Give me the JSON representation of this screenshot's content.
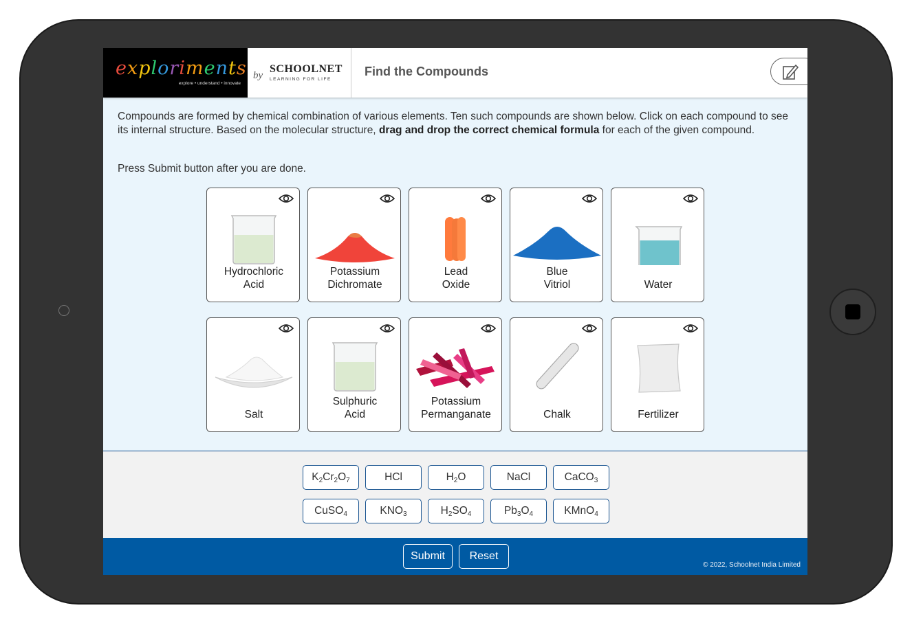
{
  "app": {
    "logo_text": "explorimenta",
    "logo_tagline": "explore • understand • innovate",
    "by": "by",
    "schoolnet_name": "SCHOOLNET",
    "schoolnet_tag": "LEARNING FOR LIFE",
    "title": "Find the Compounds",
    "notes_icon": "edit-note-icon"
  },
  "instructions": {
    "part1": "Compounds are formed by chemical combination of various elements. Ten such compounds are shown below. Click on each compound to see its internal structure. Based on the molecular structure, ",
    "bold1": "drag and drop the correct chemical formula",
    "part2": " for each of the given compound.",
    "line2": "Press Submit button after you are done."
  },
  "compounds": [
    {
      "line1": "Hydrochloric",
      "line2": "Acid"
    },
    {
      "line1": "Potassium",
      "line2": "Dichromate"
    },
    {
      "line1": "Lead",
      "line2": "Oxide"
    },
    {
      "line1": "Blue",
      "line2": "Vitriol"
    },
    {
      "line1": "Water",
      "line2": ""
    },
    {
      "line1": "Salt",
      "line2": ""
    },
    {
      "line1": "Sulphuric",
      "line2": "Acid"
    },
    {
      "line1": "Potassium",
      "line2": "Permanganate"
    },
    {
      "line1": "Chalk",
      "line2": ""
    },
    {
      "line1": "Fertilizer",
      "line2": ""
    }
  ],
  "formulas": [
    {
      "parts": [
        "K",
        "2",
        "Cr",
        "2",
        "O",
        "7"
      ]
    },
    {
      "parts": [
        "HCl"
      ]
    },
    {
      "parts": [
        "H",
        "2",
        "O"
      ]
    },
    {
      "parts": [
        "NaCl"
      ]
    },
    {
      "parts": [
        "CaCO",
        "3"
      ]
    },
    {
      "parts": [
        "CuSO",
        "4"
      ]
    },
    {
      "parts": [
        "KNO",
        "3"
      ]
    },
    {
      "parts": [
        "H",
        "2",
        "SO",
        "4"
      ]
    },
    {
      "parts": [
        "Pb",
        "3",
        "O",
        "4"
      ]
    },
    {
      "parts": [
        "KMnO",
        "4"
      ]
    }
  ],
  "footer": {
    "submit": "Submit",
    "reset": "Reset",
    "copyright": "© 2022, Schoolnet India Limited"
  },
  "colors": {
    "footer_bar": "#005aa3",
    "chip_border": "#1a5591",
    "content_bg": "#eaf5fc"
  }
}
